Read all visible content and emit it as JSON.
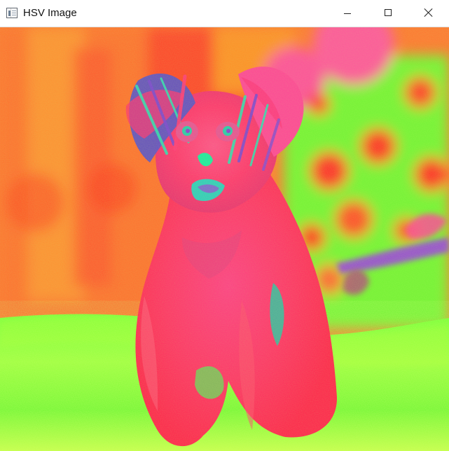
{
  "window": {
    "title": "HSV Image"
  },
  "icons": {
    "app": "app-window-icon",
    "minimize": "minimize-icon",
    "maximize": "maximize-icon",
    "close": "close-icon"
  },
  "image": {
    "description_colors": {
      "orange": "#ff6a2b",
      "yellow": "#ffd23a",
      "green": "#7dff38",
      "magenta": "#ff2f77",
      "pink": "#ff4f91",
      "cyan": "#33d8b0",
      "purple": "#8f38c8",
      "red": "#ff2424"
    }
  }
}
